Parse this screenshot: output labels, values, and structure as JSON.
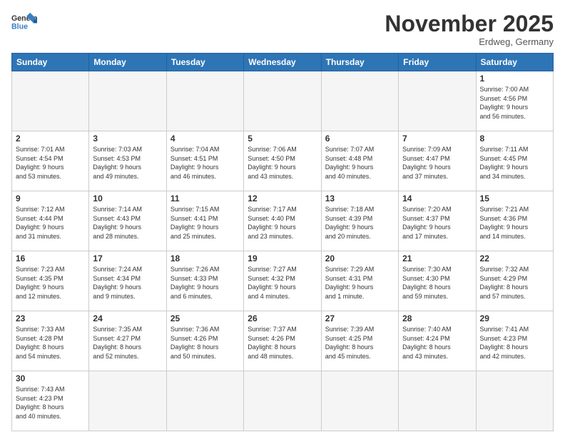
{
  "header": {
    "logo_general": "General",
    "logo_blue": "Blue",
    "month_title": "November 2025",
    "location": "Erdweg, Germany"
  },
  "weekdays": [
    "Sunday",
    "Monday",
    "Tuesday",
    "Wednesday",
    "Thursday",
    "Friday",
    "Saturday"
  ],
  "days": [
    {
      "num": "",
      "info": ""
    },
    {
      "num": "",
      "info": ""
    },
    {
      "num": "",
      "info": ""
    },
    {
      "num": "",
      "info": ""
    },
    {
      "num": "",
      "info": ""
    },
    {
      "num": "",
      "info": ""
    },
    {
      "num": "1",
      "info": "Sunrise: 7:00 AM\nSunset: 4:56 PM\nDaylight: 9 hours\nand 56 minutes."
    },
    {
      "num": "2",
      "info": "Sunrise: 7:01 AM\nSunset: 4:54 PM\nDaylight: 9 hours\nand 53 minutes."
    },
    {
      "num": "3",
      "info": "Sunrise: 7:03 AM\nSunset: 4:53 PM\nDaylight: 9 hours\nand 49 minutes."
    },
    {
      "num": "4",
      "info": "Sunrise: 7:04 AM\nSunset: 4:51 PM\nDaylight: 9 hours\nand 46 minutes."
    },
    {
      "num": "5",
      "info": "Sunrise: 7:06 AM\nSunset: 4:50 PM\nDaylight: 9 hours\nand 43 minutes."
    },
    {
      "num": "6",
      "info": "Sunrise: 7:07 AM\nSunset: 4:48 PM\nDaylight: 9 hours\nand 40 minutes."
    },
    {
      "num": "7",
      "info": "Sunrise: 7:09 AM\nSunset: 4:47 PM\nDaylight: 9 hours\nand 37 minutes."
    },
    {
      "num": "8",
      "info": "Sunrise: 7:11 AM\nSunset: 4:45 PM\nDaylight: 9 hours\nand 34 minutes."
    },
    {
      "num": "9",
      "info": "Sunrise: 7:12 AM\nSunset: 4:44 PM\nDaylight: 9 hours\nand 31 minutes."
    },
    {
      "num": "10",
      "info": "Sunrise: 7:14 AM\nSunset: 4:43 PM\nDaylight: 9 hours\nand 28 minutes."
    },
    {
      "num": "11",
      "info": "Sunrise: 7:15 AM\nSunset: 4:41 PM\nDaylight: 9 hours\nand 25 minutes."
    },
    {
      "num": "12",
      "info": "Sunrise: 7:17 AM\nSunset: 4:40 PM\nDaylight: 9 hours\nand 23 minutes."
    },
    {
      "num": "13",
      "info": "Sunrise: 7:18 AM\nSunset: 4:39 PM\nDaylight: 9 hours\nand 20 minutes."
    },
    {
      "num": "14",
      "info": "Sunrise: 7:20 AM\nSunset: 4:37 PM\nDaylight: 9 hours\nand 17 minutes."
    },
    {
      "num": "15",
      "info": "Sunrise: 7:21 AM\nSunset: 4:36 PM\nDaylight: 9 hours\nand 14 minutes."
    },
    {
      "num": "16",
      "info": "Sunrise: 7:23 AM\nSunset: 4:35 PM\nDaylight: 9 hours\nand 12 minutes."
    },
    {
      "num": "17",
      "info": "Sunrise: 7:24 AM\nSunset: 4:34 PM\nDaylight: 9 hours\nand 9 minutes."
    },
    {
      "num": "18",
      "info": "Sunrise: 7:26 AM\nSunset: 4:33 PM\nDaylight: 9 hours\nand 6 minutes."
    },
    {
      "num": "19",
      "info": "Sunrise: 7:27 AM\nSunset: 4:32 PM\nDaylight: 9 hours\nand 4 minutes."
    },
    {
      "num": "20",
      "info": "Sunrise: 7:29 AM\nSunset: 4:31 PM\nDaylight: 9 hours\nand 1 minute."
    },
    {
      "num": "21",
      "info": "Sunrise: 7:30 AM\nSunset: 4:30 PM\nDaylight: 8 hours\nand 59 minutes."
    },
    {
      "num": "22",
      "info": "Sunrise: 7:32 AM\nSunset: 4:29 PM\nDaylight: 8 hours\nand 57 minutes."
    },
    {
      "num": "23",
      "info": "Sunrise: 7:33 AM\nSunset: 4:28 PM\nDaylight: 8 hours\nand 54 minutes."
    },
    {
      "num": "24",
      "info": "Sunrise: 7:35 AM\nSunset: 4:27 PM\nDaylight: 8 hours\nand 52 minutes."
    },
    {
      "num": "25",
      "info": "Sunrise: 7:36 AM\nSunset: 4:26 PM\nDaylight: 8 hours\nand 50 minutes."
    },
    {
      "num": "26",
      "info": "Sunrise: 7:37 AM\nSunset: 4:26 PM\nDaylight: 8 hours\nand 48 minutes."
    },
    {
      "num": "27",
      "info": "Sunrise: 7:39 AM\nSunset: 4:25 PM\nDaylight: 8 hours\nand 45 minutes."
    },
    {
      "num": "28",
      "info": "Sunrise: 7:40 AM\nSunset: 4:24 PM\nDaylight: 8 hours\nand 43 minutes."
    },
    {
      "num": "29",
      "info": "Sunrise: 7:41 AM\nSunset: 4:23 PM\nDaylight: 8 hours\nand 42 minutes."
    },
    {
      "num": "30",
      "info": "Sunrise: 7:43 AM\nSunset: 4:23 PM\nDaylight: 8 hours\nand 40 minutes."
    },
    {
      "num": "",
      "info": ""
    },
    {
      "num": "",
      "info": ""
    },
    {
      "num": "",
      "info": ""
    },
    {
      "num": "",
      "info": ""
    },
    {
      "num": "",
      "info": ""
    },
    {
      "num": "",
      "info": ""
    }
  ]
}
